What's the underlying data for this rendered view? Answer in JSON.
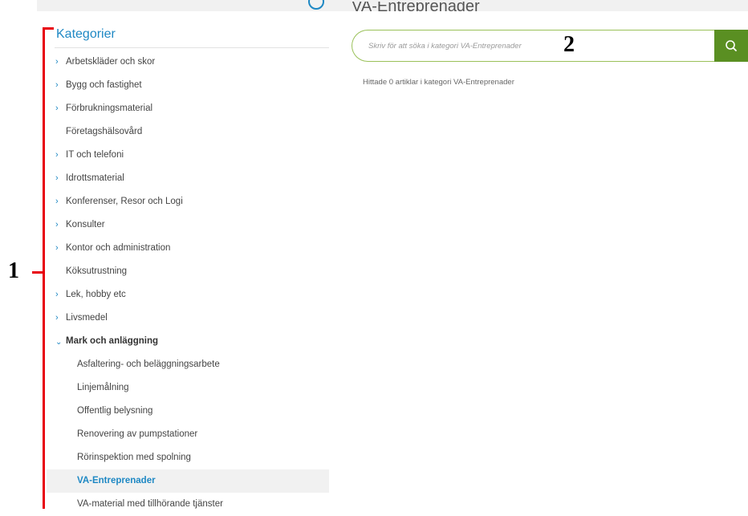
{
  "header": {
    "page_title": "VA-Entreprenader"
  },
  "sidebar": {
    "title": "Kategorier",
    "items": [
      {
        "label": "Arbetskläder och skor",
        "has_chevron": true
      },
      {
        "label": "Bygg och fastighet",
        "has_chevron": true
      },
      {
        "label": "Förbrukningsmaterial",
        "has_chevron": true
      },
      {
        "label": "Företagshälsovård",
        "has_chevron": false
      },
      {
        "label": "IT och telefoni",
        "has_chevron": true
      },
      {
        "label": "Idrottsmaterial",
        "has_chevron": true
      },
      {
        "label": "Konferenser, Resor och Logi",
        "has_chevron": true
      },
      {
        "label": "Konsulter",
        "has_chevron": true
      },
      {
        "label": "Kontor och administration",
        "has_chevron": true
      },
      {
        "label": "Köksutrustning",
        "has_chevron": false
      },
      {
        "label": "Lek, hobby etc",
        "has_chevron": true
      },
      {
        "label": "Livsmedel",
        "has_chevron": true
      },
      {
        "label": "Mark och anläggning",
        "has_chevron": true,
        "expanded": true
      }
    ],
    "subitems": [
      {
        "label": "Asfaltering- och beläggningsarbete"
      },
      {
        "label": "Linjemålning"
      },
      {
        "label": "Offentlig belysning"
      },
      {
        "label": "Renovering av pumpstationer"
      },
      {
        "label": "Rörinspektion med spolning"
      },
      {
        "label": "VA-Entreprenader",
        "selected": true
      },
      {
        "label": "VA-material med tillhörande tjänster"
      }
    ]
  },
  "search": {
    "placeholder": "Skriv för att söka i kategori VA-Entreprenader",
    "value": ""
  },
  "results": {
    "text": "Hittade 0 artiklar i kategori VA-Entreprenader"
  },
  "annotations": {
    "marker_1": "1",
    "marker_2": "2"
  },
  "colors": {
    "accent": "#1e88c4",
    "search_button": "#5a8f22",
    "search_border": "#9ac15a",
    "annotation": "#e8000d",
    "selected_bg": "#f1f1f1"
  },
  "icons": {
    "chevron_right": "chevron-right-icon",
    "chevron_down": "chevron-down-icon",
    "search": "search-icon",
    "top": "user-circle-icon"
  }
}
